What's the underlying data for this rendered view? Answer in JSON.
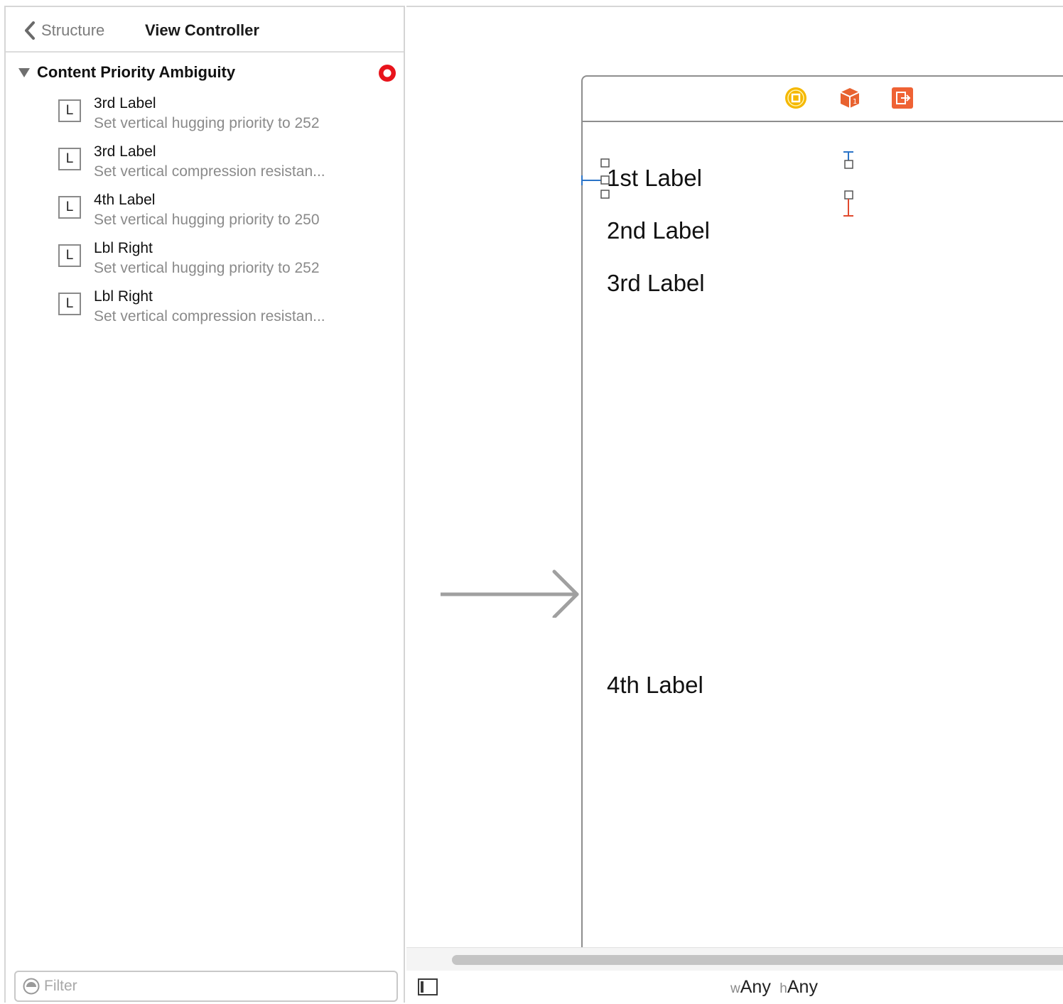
{
  "navigator": {
    "back_label": "Structure",
    "title": "View Controller",
    "group": {
      "title": "Content Priority Ambiguity",
      "status": "error"
    },
    "issues": [
      {
        "icon_letter": "L",
        "title": "3rd Label",
        "detail": "Set vertical hugging priority to 252"
      },
      {
        "icon_letter": "L",
        "title": "3rd Label",
        "detail": "Set vertical compression resistan..."
      },
      {
        "icon_letter": "L",
        "title": "4th Label",
        "detail": "Set vertical hugging priority to 250"
      },
      {
        "icon_letter": "L",
        "title": "Lbl Right",
        "detail": "Set vertical hugging priority to 252"
      },
      {
        "icon_letter": "L",
        "title": "Lbl Right",
        "detail": "Set vertical compression resistan..."
      }
    ],
    "filter": {
      "placeholder": "Filter",
      "value": ""
    }
  },
  "canvas": {
    "dock_icons": [
      "view-controller-icon",
      "first-responder-icon",
      "exit-icon"
    ],
    "labels": [
      "1st Label",
      "2nd Label",
      "3rd Label",
      "4th Label"
    ],
    "size_class": {
      "w_prefix": "w",
      "w_value": "Any",
      "h_prefix": "h",
      "h_value": "Any"
    }
  },
  "colors": {
    "error": "#e8141c",
    "view_controller_icon": "#f5b800",
    "cube_icon": "#e8622f",
    "exit_icon": "#ef6234",
    "constraint_blue": "#2b74c7",
    "constraint_red": "#e14a2e"
  }
}
